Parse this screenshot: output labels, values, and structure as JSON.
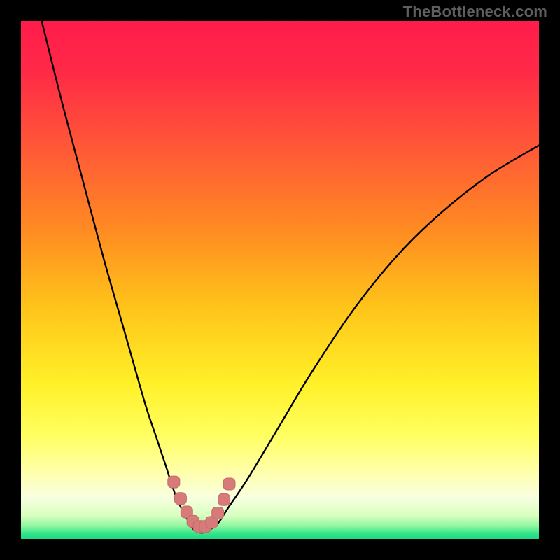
{
  "watermark": "TheBottleneck.com",
  "colors": {
    "frame": "#000000",
    "gradient_stops": [
      {
        "offset": 0.0,
        "color": "#ff1c4b"
      },
      {
        "offset": 0.1,
        "color": "#ff2a46"
      },
      {
        "offset": 0.25,
        "color": "#ff5a36"
      },
      {
        "offset": 0.4,
        "color": "#ff8a22"
      },
      {
        "offset": 0.55,
        "color": "#ffc31a"
      },
      {
        "offset": 0.7,
        "color": "#fff028"
      },
      {
        "offset": 0.8,
        "color": "#ffff60"
      },
      {
        "offset": 0.87,
        "color": "#ffffaa"
      },
      {
        "offset": 0.92,
        "color": "#f8ffe0"
      },
      {
        "offset": 0.955,
        "color": "#d8ffc0"
      },
      {
        "offset": 0.975,
        "color": "#90f7a0"
      },
      {
        "offset": 0.99,
        "color": "#30e58a"
      },
      {
        "offset": 1.0,
        "color": "#1fd884"
      }
    ],
    "curve_stroke": "#000000",
    "marker_fill": "#d77a7a",
    "marker_stroke": "#c96a6a"
  },
  "chart_data": {
    "type": "line",
    "title": "",
    "xlabel": "",
    "ylabel": "",
    "xlim": [
      0,
      100
    ],
    "ylim": [
      0,
      100
    ],
    "grid": false,
    "legend": false,
    "note": "Axes and tick labels are not rendered in the source image; values below are estimated from pixel positions on a 0–100 normalized range.",
    "series": [
      {
        "name": "bottleneck-curve",
        "x": [
          4,
          8,
          12,
          16,
          20,
          24,
          26,
          28,
          30,
          32,
          33,
          34,
          35,
          36,
          38,
          40,
          44,
          50,
          56,
          64,
          72,
          80,
          90,
          100
        ],
        "y": [
          100,
          84,
          69,
          54,
          40,
          26,
          20,
          14,
          8,
          4,
          2.2,
          1.4,
          1.2,
          1.5,
          3,
          6,
          12,
          22,
          32,
          44,
          54,
          62,
          70,
          76
        ]
      }
    ],
    "markers": {
      "name": "highlighted-points",
      "x": [
        29.5,
        30.8,
        32.0,
        33.2,
        34.4,
        35.6,
        36.8,
        38.0,
        39.2,
        40.2
      ],
      "y": [
        11.0,
        7.8,
        5.2,
        3.4,
        2.4,
        2.4,
        3.2,
        5.0,
        7.6,
        10.6
      ]
    }
  }
}
